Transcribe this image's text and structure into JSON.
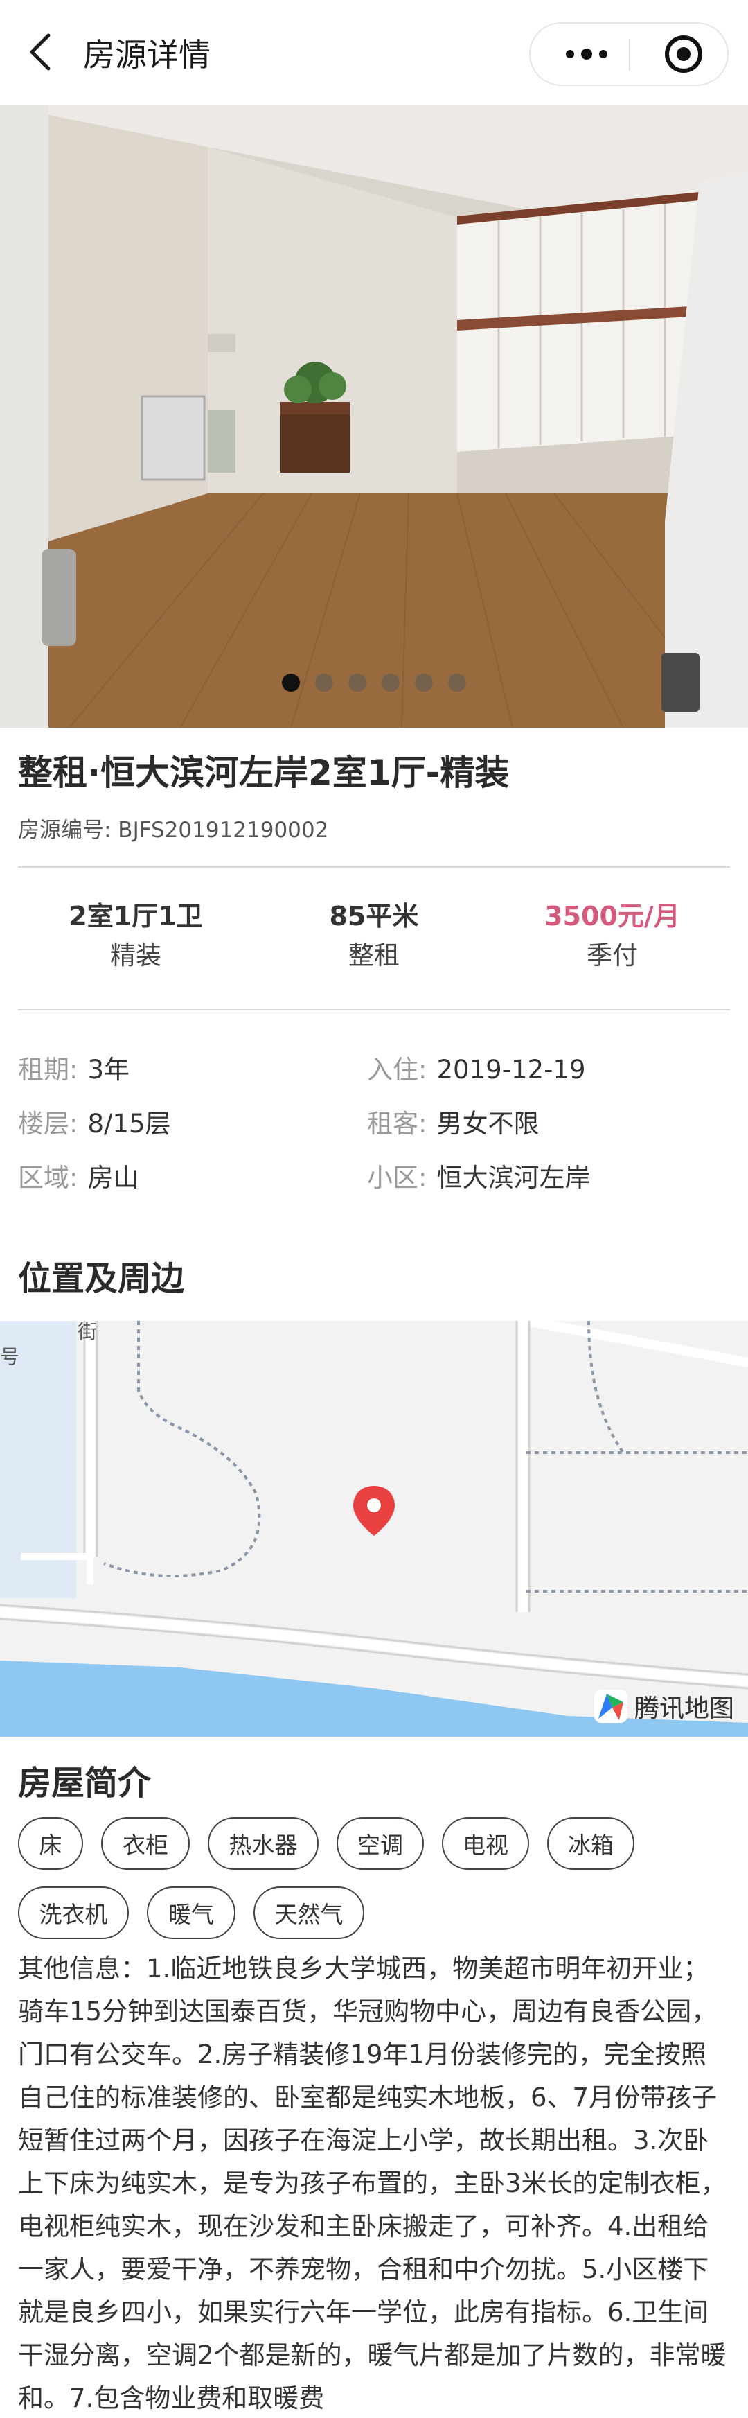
{
  "nav": {
    "title": "房源详情"
  },
  "gallery": {
    "image_count": 6,
    "active_index": 1
  },
  "house": {
    "title": "整租·恒大滨河左岸2室1厅-精装",
    "code": "房源编号: BJFS201912190002"
  },
  "stats": [
    {
      "value": "2室1厅1卫",
      "sub": "精装"
    },
    {
      "value": "85平米",
      "sub": "整租"
    },
    {
      "value": "3500元/月",
      "sub": "季付"
    }
  ],
  "details": {
    "lease": {
      "key": "租期:",
      "value": "3年"
    },
    "move_in": {
      "key": "入住:",
      "value": "2019-12-19"
    },
    "floor": {
      "key": "楼层:",
      "value": "8/15层"
    },
    "tenant": {
      "key": "租客:",
      "value": "男女不限"
    },
    "area": {
      "key": "区域:",
      "value": "房山"
    },
    "community": {
      "key": "小区:",
      "value": "恒大滨河左岸"
    }
  },
  "location": {
    "heading": "位置及周边",
    "map_provider": "腾讯地图",
    "street_fragment": "街",
    "number_fragment": "号"
  },
  "intro": {
    "heading": "房屋简介",
    "tags_row1": [
      "床",
      "衣柜",
      "热水器",
      "空调",
      "电视",
      "冰箱"
    ],
    "tags_row2": [
      "洗衣机",
      "暖气",
      "天然气"
    ],
    "description": "其他信息：1.临近地铁良乡大学城西，物美超市明年初开业；骑车15分钟到达国泰百货，华冠购物中心，周边有良香公园，门口有公交车。2.房子精装修19年1月份装修完的，完全按照自己住的标准装修的、卧室都是纯实木地板，6、7月份带孩子短暂住过两个月，因孩子在海淀上小学，故长期出租。3.次卧上下床为纯实木，是专为孩子布置的，主卧3米长的定制衣柜，电视柜纯实木，现在沙发和主卧床搬走了，可补齐。4.出租给一家人，要爱干净，不养宠物，合租和中介勿扰。5.小区楼下就是良乡四小，如果实行六年一学位，此房有指标。6.卫生间干湿分离，空调2个都是新的，暖气片都是加了片数的，非常暖和。7.包含物业费和取暖费"
  },
  "colors": {
    "price": "#d45a7c",
    "map_pin": "#e8403f",
    "water": "#8dc7f2"
  }
}
